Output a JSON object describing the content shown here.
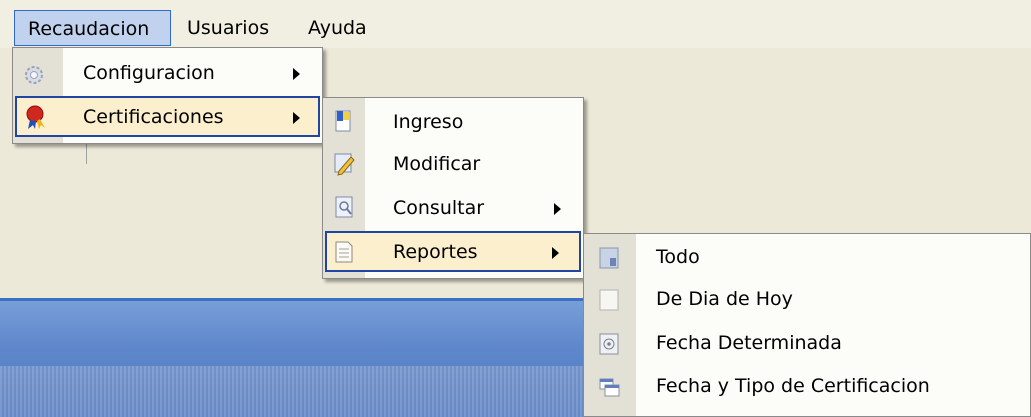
{
  "menubar": {
    "items": [
      "Recaudacion",
      "Usuarios",
      "Ayuda"
    ]
  },
  "recaudacion_menu": {
    "items": [
      {
        "label": "Configuracion",
        "icon": "gear-icon",
        "has_submenu": true
      },
      {
        "label": "Certificaciones",
        "icon": "ribbon-seal-icon",
        "has_submenu": true,
        "active": true
      }
    ]
  },
  "certificaciones_menu": {
    "items": [
      {
        "label": "Ingreso",
        "icon": "flag-document-icon",
        "has_submenu": false
      },
      {
        "label": "Modificar",
        "icon": "edit-document-icon",
        "has_submenu": false
      },
      {
        "label": "Consultar",
        "icon": "search-document-icon",
        "has_submenu": true
      },
      {
        "label": "Reportes",
        "icon": "report-document-icon",
        "has_submenu": true,
        "active": true
      }
    ]
  },
  "reportes_menu": {
    "items": [
      {
        "label": "Todo",
        "icon": "list-icon"
      },
      {
        "label": "De Dia de Hoy",
        "icon": "blank-page-icon"
      },
      {
        "label": "Fecha Determinada",
        "icon": "calendar-target-icon"
      },
      {
        "label": "Fecha y Tipo de Certificacion",
        "icon": "windows-icon"
      }
    ]
  },
  "colors": {
    "highlight_bg": "#fcefcd",
    "highlight_border": "#2145a0",
    "menubar_selected": "#c1d2ee",
    "taskbar_blue": "#5f88cc"
  }
}
